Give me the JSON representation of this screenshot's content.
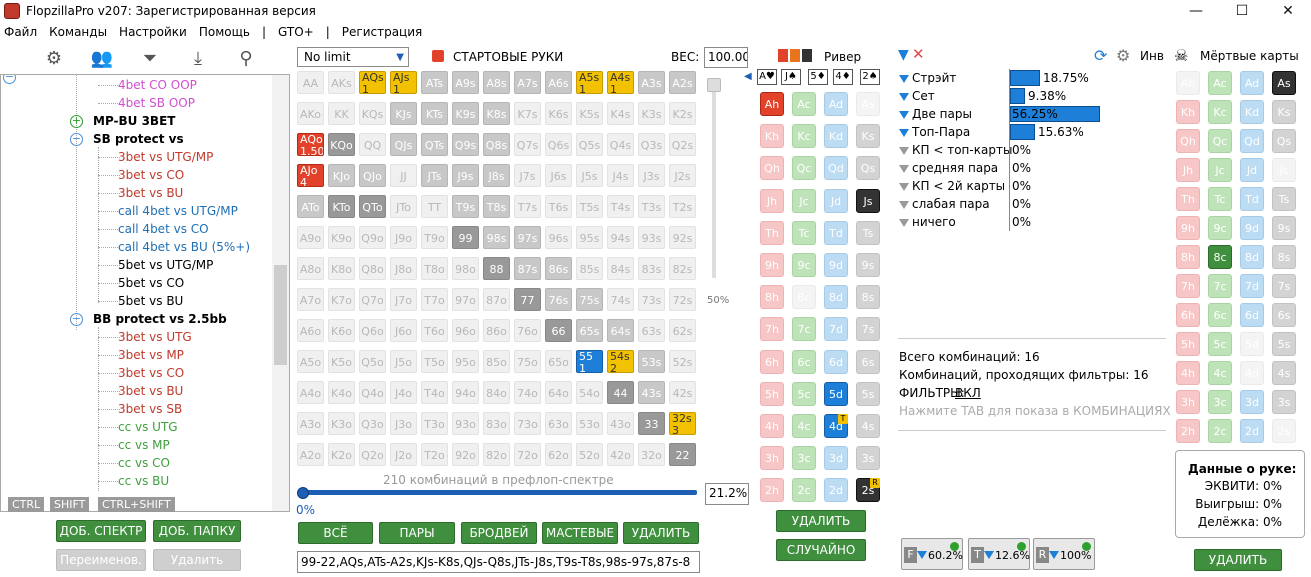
{
  "window": {
    "title": "FlopzillaPro v207: Зарегистрированная версия"
  },
  "menu": [
    "Файл",
    "Команды",
    "Настройки",
    "Помощь",
    "|",
    "GTO+",
    "|",
    "Регистрация"
  ],
  "tree": {
    "items": [
      {
        "label": "4bet CO OOP",
        "color": "#d14fd1"
      },
      {
        "label": "4bet SB OOP",
        "color": "#d14fd1"
      },
      {
        "label": "MP-BU 3BET",
        "color": "#000",
        "bold": true
      },
      {
        "label": "SB protect vs",
        "color": "#000",
        "bold": true
      },
      {
        "label": "3bet vs UTG/MP",
        "color": "#c0392b"
      },
      {
        "label": "3bet vs CO",
        "color": "#c0392b"
      },
      {
        "label": "3bet vs BU",
        "color": "#c0392b"
      },
      {
        "label": "call 4bet vs UTG/MP",
        "color": "#1e6fb4"
      },
      {
        "label": "call 4bet vs CO",
        "color": "#1e6fb4"
      },
      {
        "label": "call 4bet vs BU (5%+)",
        "color": "#1e6fb4"
      },
      {
        "label": "5bet vs UTG/MP",
        "color": "#000"
      },
      {
        "label": "5bet vs CO",
        "color": "#000"
      },
      {
        "label": "5bet vs BU",
        "color": "#000"
      },
      {
        "label": "BB protect vs 2.5bb",
        "color": "#000",
        "bold": true
      },
      {
        "label": "3bet vs UTG",
        "color": "#c0392b"
      },
      {
        "label": "3bet vs MP",
        "color": "#c0392b"
      },
      {
        "label": "3bet vs CO",
        "color": "#c0392b"
      },
      {
        "label": "3bet vs BU",
        "color": "#c0392b"
      },
      {
        "label": "3bet vs SB",
        "color": "#c0392b"
      },
      {
        "label": "cc vs UTG",
        "color": "#3f9f3f"
      },
      {
        "label": "cc vs MP",
        "color": "#3f9f3f"
      },
      {
        "label": "cc vs CO",
        "color": "#3f9f3f"
      },
      {
        "label": "cc vs BU",
        "color": "#3f9f3f"
      }
    ]
  },
  "keys": [
    "CTRL",
    "SHIFT",
    "CTRL+SHIFT"
  ],
  "left_buttons": {
    "add_range": "ДОБ. СПЕКТР",
    "add_folder": "ДОБ. ПАПКУ",
    "rename": "Переименов.",
    "delete": "Удалить"
  },
  "range": {
    "limit": "No limit",
    "starting_hands": "СТАРТОВЫЕ РУКИ",
    "weight_label": "ВЕС:",
    "weight": "100.00",
    "slider_pct": "50%",
    "combo_caption": "210 комбинаций в префлоп-спектре",
    "start_pct": "0%",
    "range_pct": "21.2%",
    "range_text": "99-22,AQs,ATs-A2s,KJs-K8s,QJs-Q8s,JTs-J8s,T9s-T8s,98s-97s,87s-8",
    "buttons": [
      "ВСЁ",
      "ПАРЫ",
      "БРОДВЕЙ",
      "МАСТЕВЫЕ",
      "УДАЛИТЬ"
    ],
    "grid": [
      [
        "AA",
        "AKs",
        "AQs",
        "AJs",
        "ATs",
        "A9s",
        "A8s",
        "A7s",
        "A6s",
        "A5s",
        "A4s",
        "A3s",
        "A2s"
      ],
      [
        "AKo",
        "KK",
        "KQs",
        "KJs",
        "KTs",
        "K9s",
        "K8s",
        "K7s",
        "K6s",
        "K5s",
        "K4s",
        "K3s",
        "K2s"
      ],
      [
        "AQo",
        "KQo",
        "QQ",
        "QJs",
        "QTs",
        "Q9s",
        "Q8s",
        "Q7s",
        "Q6s",
        "Q5s",
        "Q4s",
        "Q3s",
        "Q2s"
      ],
      [
        "AJo",
        "KJo",
        "QJo",
        "JJ",
        "JTs",
        "J9s",
        "J8s",
        "J7s",
        "J6s",
        "J5s",
        "J4s",
        "J3s",
        "J2s"
      ],
      [
        "ATo",
        "KTo",
        "QTo",
        "JTo",
        "TT",
        "T9s",
        "T8s",
        "T7s",
        "T6s",
        "T5s",
        "T4s",
        "T3s",
        "T2s"
      ],
      [
        "A9o",
        "K9o",
        "Q9o",
        "J9o",
        "T9o",
        "99",
        "98s",
        "97s",
        "96s",
        "95s",
        "94s",
        "93s",
        "92s"
      ],
      [
        "A8o",
        "K8o",
        "Q8o",
        "J8o",
        "T8o",
        "98o",
        "88",
        "87s",
        "86s",
        "85s",
        "84s",
        "83s",
        "82s"
      ],
      [
        "A7o",
        "K7o",
        "Q7o",
        "J7o",
        "T7o",
        "97o",
        "87o",
        "77",
        "76s",
        "75s",
        "74s",
        "73s",
        "72s"
      ],
      [
        "A6o",
        "K6o",
        "Q6o",
        "J6o",
        "T6o",
        "96o",
        "86o",
        "76o",
        "66",
        "65s",
        "64s",
        "63s",
        "62s"
      ],
      [
        "A5o",
        "K5o",
        "Q5o",
        "J5o",
        "T5o",
        "95o",
        "85o",
        "75o",
        "65o",
        "55",
        "54s",
        "53s",
        "52s"
      ],
      [
        "A4o",
        "K4o",
        "Q4o",
        "J4o",
        "T4o",
        "94o",
        "84o",
        "74o",
        "64o",
        "54o",
        "44",
        "43s",
        "42s"
      ],
      [
        "A3o",
        "K3o",
        "Q3o",
        "J3o",
        "T3o",
        "93o",
        "83o",
        "73o",
        "63o",
        "53o",
        "43o",
        "33",
        "32s"
      ],
      [
        "A2o",
        "K2o",
        "Q2o",
        "J2o",
        "T2o",
        "92o",
        "82o",
        "72o",
        "62o",
        "52o",
        "42o",
        "32o",
        "22"
      ]
    ],
    "cell_counts": {
      "AQs": "1",
      "AJs": "1",
      "A5s": "1",
      "A4s": "1",
      "AQo": "1.50",
      "AJo": "4",
      "55": "1",
      "54s": "2",
      "32s": "3"
    }
  },
  "board": {
    "title": "Ривер",
    "street_cards": [
      "A♥",
      "J♠",
      "5♦",
      "4♦",
      "2♠"
    ],
    "ranks": [
      "A",
      "K",
      "Q",
      "J",
      "T",
      "9",
      "8",
      "7",
      "6",
      "5",
      "4",
      "3",
      "2"
    ],
    "buttons": {
      "delete": "УДАЛИТЬ",
      "random": "СЛУЧАЙНО"
    }
  },
  "stats": {
    "header_eq": "Инв",
    "rows": [
      {
        "label": "Стрэйт",
        "pct": "18.75%",
        "value": 18.75,
        "active": true
      },
      {
        "label": "Сет",
        "pct": "9.38%",
        "value": 9.38,
        "active": true
      },
      {
        "label": "Две пары",
        "pct": "56.25%",
        "value": 56.25,
        "active": true
      },
      {
        "label": "Топ-Пара",
        "pct": "15.63%",
        "value": 15.63,
        "active": true
      },
      {
        "label": "КП < топ-карты",
        "pct": "0%",
        "value": 0,
        "active": false
      },
      {
        "label": "средняя пара",
        "pct": "0%",
        "value": 0,
        "active": false
      },
      {
        "label": "КП < 2й карты",
        "pct": "0%",
        "value": 0,
        "active": false
      },
      {
        "label": "слабая пара",
        "pct": "0%",
        "value": 0,
        "active": false
      },
      {
        "label": "ничего",
        "pct": "0%",
        "value": 0,
        "active": false
      }
    ],
    "total_combos": "Всего комбинаций: 16",
    "passing_combos": "Комбинаций, проходящих фильтры: 16",
    "filters_label": "ФИЛЬТРЫ:",
    "filters_value": "ВКЛ",
    "tab_hint": "Нажмите TAB для показа в КОМБИНАЦИЯХ",
    "filter_buttons": [
      {
        "letter": "F",
        "value": "60.2%"
      },
      {
        "letter": "T",
        "value": "12.6%"
      },
      {
        "letter": "R",
        "value": "100%"
      }
    ]
  },
  "dead": {
    "title": "Мёртвые карты",
    "info_title": "Данные о руке:",
    "equity": "ЭКВИТИ: 0%",
    "win": "Выигрыш: 0%",
    "tie": "Делёжка: 0%",
    "delete": "УДАЛИТЬ"
  }
}
